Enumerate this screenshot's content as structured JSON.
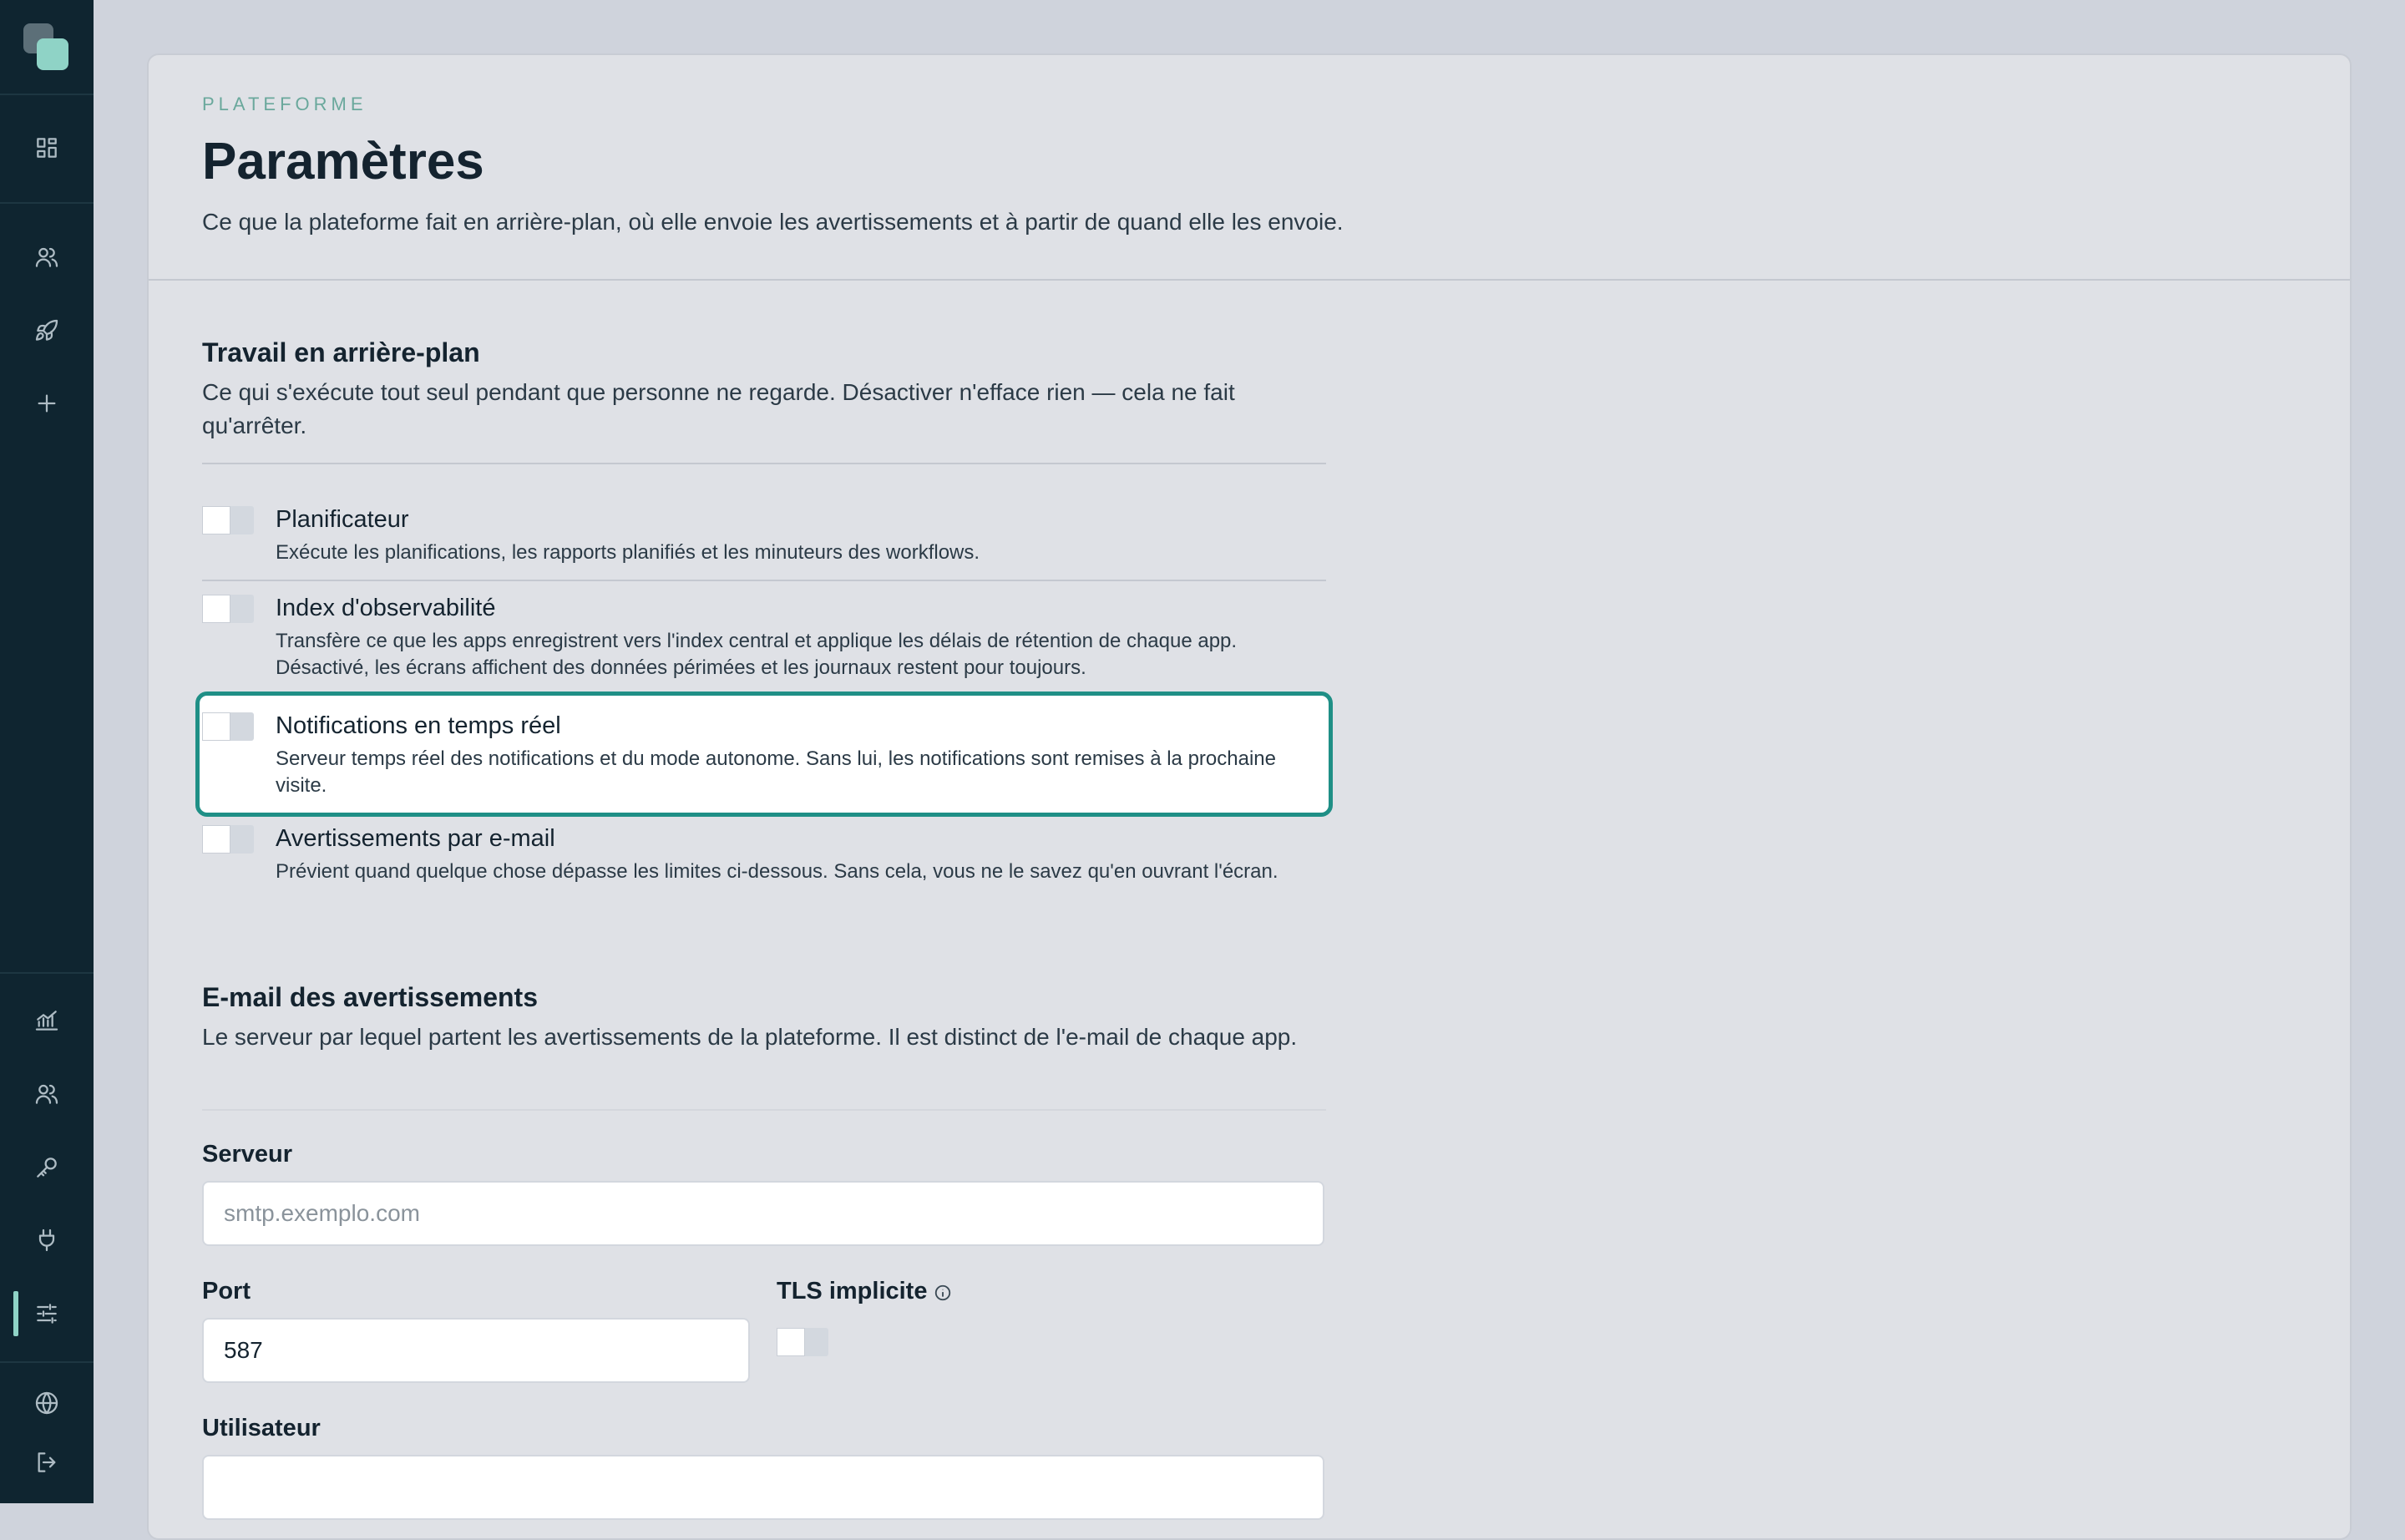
{
  "header": {
    "eyebrow": "PLATEFORME",
    "title": "Paramètres",
    "subtitle": "Ce que la plateforme fait en arrière-plan, où elle envoie les avertissements et à partir de quand elle les envoie."
  },
  "background": {
    "title": "Travail en arrière-plan",
    "desc": "Ce qui s'exécute tout seul pendant que personne ne regarde. Désactiver n'efface rien — cela ne fait qu'arrêter.",
    "toggles": [
      {
        "label": "Planificateur",
        "desc": "Exécute les planifications, les rapports planifiés et les minuteurs des workflows.",
        "on": false
      },
      {
        "label": "Index d'observabilité",
        "desc": "Transfère ce que les apps enregistrent vers l'index central et applique les délais de rétention de chaque app. Désactivé, les écrans affichent des données périmées et les journaux restent pour toujours.",
        "on": false
      },
      {
        "label": "Notifications en temps réel",
        "desc": "Serveur temps réel des notifications et du mode autonome. Sans lui, les notifications sont remises à la prochaine visite.",
        "on": false,
        "focused": true
      },
      {
        "label": "Avertissements par e-mail",
        "desc": "Prévient quand quelque chose dépasse les limites ci-dessous. Sans cela, vous ne le savez qu'en ouvrant l'écran.",
        "on": false
      }
    ]
  },
  "email": {
    "title": "E-mail des avertissements",
    "desc": "Le serveur par lequel partent les avertissements de la plateforme. Il est distinct de l'e-mail de chaque app.",
    "server_label": "Serveur",
    "server_placeholder": "smtp.exemplo.com",
    "server_value": "",
    "port_label": "Port",
    "port_value": "587",
    "tls_label": "TLS implicite",
    "tls_on": false,
    "user_label": "Utilisateur",
    "user_value": ""
  },
  "colors": {
    "sidebar": "#0f2530",
    "accent": "#8fd3c6",
    "focus_ring": "#1f8f86",
    "panel": "#dfe1e6"
  },
  "sidebar_icons": [
    "dashboard-icon",
    "users-icon",
    "rocket-icon",
    "plus-icon",
    "chart-icon",
    "team-icon",
    "key-icon",
    "plug-icon",
    "sliders-icon",
    "globe-icon",
    "logout-icon"
  ]
}
